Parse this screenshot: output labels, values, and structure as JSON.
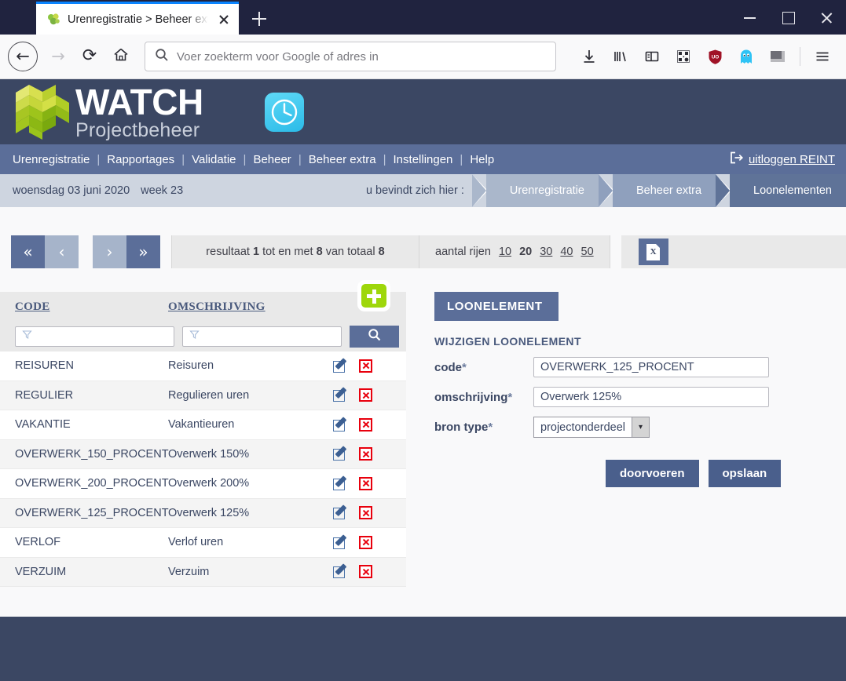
{
  "browser": {
    "tab": {
      "title": "Urenregistratie > Beheer extra",
      "favicon": "puzzle-leaf-icon",
      "close_label": "×"
    },
    "newtab_label": "+",
    "window_controls": {
      "minimize": "−",
      "maximize": "□",
      "close": "×"
    },
    "back_label": "←",
    "forward_label": "→",
    "reload_label": "⟳",
    "home_label": "⌂",
    "url_placeholder": "Voer zoekterm voor Google of adres in",
    "toolbar_icons": [
      "download-icon",
      "library-icon",
      "sidebar-icon",
      "qr-icon",
      "shield-icon",
      "ghost-icon",
      "extension-icon",
      "menu-icon"
    ]
  },
  "app": {
    "logo": {
      "brand": "WATCH",
      "tagline": "Projectbeheer"
    },
    "clock_icon": "clock-icon",
    "nav": {
      "items": [
        "Urenregistratie",
        "Rapportages",
        "Validatie",
        "Beheer",
        "Beheer extra",
        "Instellingen",
        "Help"
      ],
      "separator": "|",
      "logout_label": "uitloggen REINT"
    },
    "breadcrumb": {
      "date": "woensdag 03 juni 2020",
      "week": "week 23",
      "hint": "u bevindt zich hier :",
      "segments": [
        {
          "label": "Urenregistratie",
          "color": "#aab7cb"
        },
        {
          "label": "Beheer extra",
          "color": "#8fa0bd"
        },
        {
          "label": "Loonelementen",
          "color": "#5f7398"
        }
      ]
    }
  },
  "toolbar": {
    "pager": [
      {
        "label": "«",
        "style": "dark",
        "name": "first-page-button"
      },
      {
        "label": "‹",
        "style": "light",
        "name": "prev-page-button"
      },
      {
        "label": "›",
        "style": "light",
        "name": "next-page-button"
      },
      {
        "label": "»",
        "style": "dark",
        "name": "last-page-button"
      }
    ],
    "result_prefix": "resultaat",
    "result_from": "1",
    "result_mid": "tot en met",
    "result_to": "8",
    "result_of": "van totaal",
    "result_total": "8",
    "rows_label": "aantal rijen",
    "rows_options": [
      "10",
      "20",
      "30",
      "40",
      "50"
    ],
    "rows_selected": "20",
    "excel_label": "X",
    "excel_name": "excel-export-button"
  },
  "table": {
    "headers": {
      "code": "CODE",
      "omschrijving": "OMSCHRIJVING"
    },
    "filter_placeholder": "",
    "search_label": "search-icon",
    "add_label": "+",
    "rows": [
      {
        "code": "REISUREN",
        "omschrijving": "Reisuren"
      },
      {
        "code": "REGULIER",
        "omschrijving": "Regulieren uren"
      },
      {
        "code": "VAKANTIE",
        "omschrijving": "Vakantieuren"
      },
      {
        "code": "OVERWERK_150_PROCENT",
        "omschrijving": "Overwerk 150%"
      },
      {
        "code": "OVERWERK_200_PROCENT",
        "omschrijving": "Overwerk 200%"
      },
      {
        "code": "OVERWERK_125_PROCENT",
        "omschrijving": "Overwerk 125%"
      },
      {
        "code": "VERLOF",
        "omschrijving": "Verlof uren"
      },
      {
        "code": "VERZUIM",
        "omschrijving": "Verzuim"
      }
    ]
  },
  "form": {
    "panel_title": "LOONELEMENT",
    "section_title": "WIJZIGEN LOONELEMENT",
    "fields": [
      {
        "label": "code",
        "required": "*",
        "value": "OVERWERK_125_PROCENT"
      },
      {
        "label": "omschrijving",
        "required": "*",
        "value": "Overwerk 125%"
      },
      {
        "label": "bron type",
        "required": "*",
        "value": "projectonderdeel"
      }
    ],
    "select_arrow": "▾",
    "buttons": [
      {
        "label": "doorvoeren",
        "name": "doorvoeren-button"
      },
      {
        "label": "opslaan",
        "name": "opslaan-button"
      }
    ]
  },
  "colors": {
    "header_dark": "#3b4763",
    "nav_blue": "#5b6e99",
    "breadcrumb_bg": "#ced5e0",
    "accent_green": "#9ed70b",
    "danger_red": "#e8000d",
    "tab_accent": "#0a84ff"
  }
}
